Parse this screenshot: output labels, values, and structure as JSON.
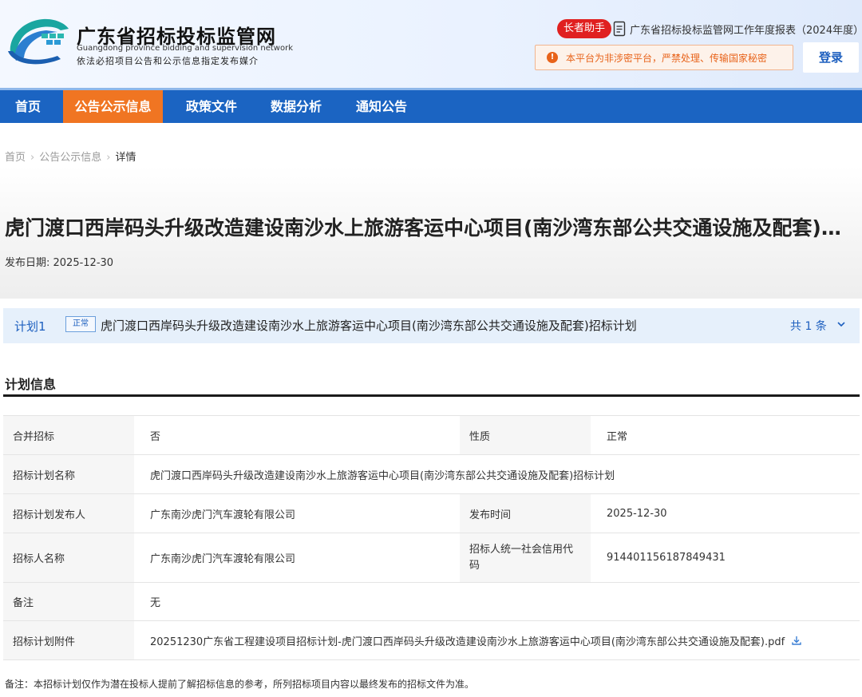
{
  "header": {
    "site_title": "广东省招标投标监管网",
    "site_title_en": "Guangdong province bidding and supervision network",
    "site_subtitle": "依法必招项目公告和公示信息指定发布媒介",
    "assistant_label": "长者助手",
    "report_link": "广东省招标投标监管网工作年度报表（2024年度）",
    "warning_text": "本平台为非涉密平台，严禁处理、传输国家秘密",
    "login_label": "登录"
  },
  "nav": {
    "items": [
      "首页",
      "公告公示信息",
      "政策文件",
      "数据分析",
      "通知公告"
    ],
    "active": "公告公示信息"
  },
  "breadcrumb": {
    "home": "首页",
    "level2": "公告公示信息",
    "current": "详情"
  },
  "article": {
    "title": "虎门渡口西岸码头升级改造建设南沙水上旅游客运中心项目(南沙湾东部公共交通设施及配套)招标计划",
    "date_label": "发布日期: 2025-12-30"
  },
  "plan_bar": {
    "label": "计划1",
    "tag": "正常",
    "name": "虎门渡口西岸码头升级改造建设南沙水上旅游客运中心项目(南沙湾东部公共交通设施及配套)招标计划",
    "count": "共 1 条"
  },
  "section": {
    "title": "计划信息"
  },
  "table": {
    "merge_label": "合并招标",
    "merge_value": "否",
    "nature_label": "性质",
    "nature_value": "正常",
    "plan_name_label": "招标计划名称",
    "plan_name_value": "虎门渡口西岸码头升级改造建设南沙水上旅游客运中心项目(南沙湾东部公共交通设施及配套)招标计划",
    "publisher_label": "招标计划发布人",
    "publisher_value": "广东南沙虎门汽车渡轮有限公司",
    "pubtime_label": "发布时间",
    "pubtime_value": "2025-12-30",
    "tenderer_label": "招标人名称",
    "tenderer_value": "广东南沙虎门汽车渡轮有限公司",
    "credit_label": "招标人统一社会信用代码",
    "credit_value": "914401156187849431",
    "remark_label": "备注",
    "remark_value": "无",
    "attach_label": "招标计划附件",
    "attach_value": "20251230广东省工程建设项目招标计划-虎门渡口西岸码头升级改造建设南沙水上旅游客运中心项目(南沙湾东部公共交通设施及配套).pdf"
  },
  "footnote": "备注：本招标计划仅作为潜在投标人提前了解招标信息的参考，所列招标项目内容以最终发布的招标文件为准。",
  "colors": {
    "brand_blue": "#1b64c2",
    "active_orange": "#f07522",
    "alert_red": "#e02020"
  }
}
